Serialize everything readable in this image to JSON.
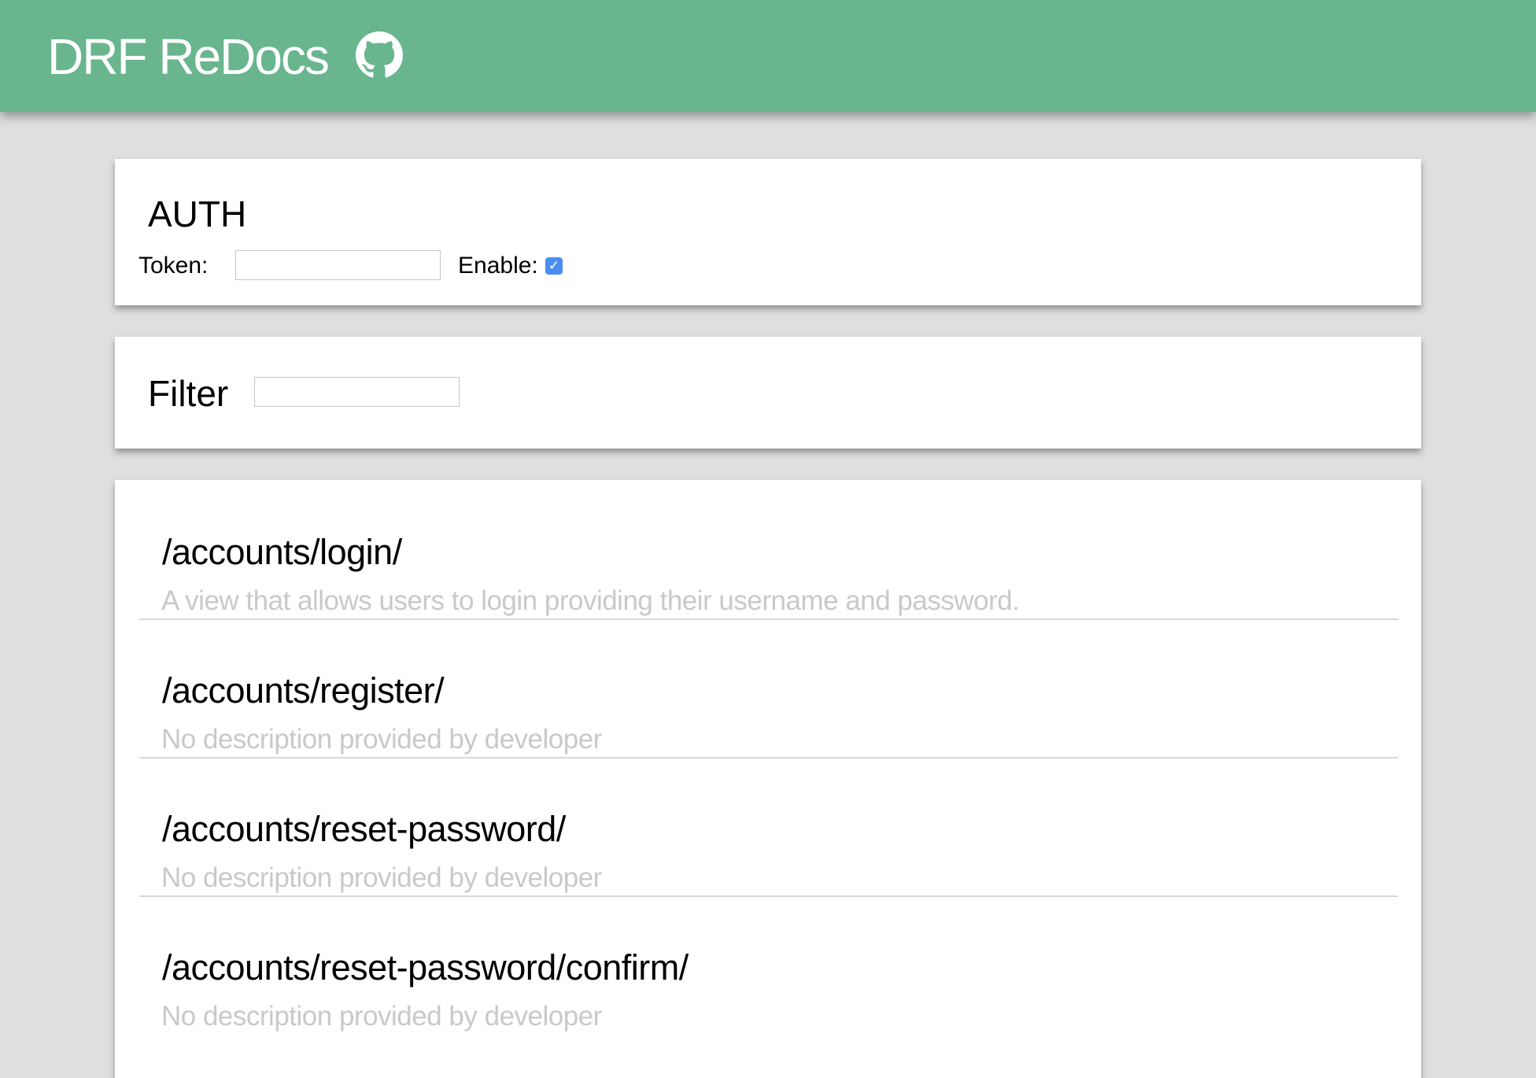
{
  "header": {
    "title": "DRF ReDocs",
    "icon": "github-icon"
  },
  "auth": {
    "title": "AUTH",
    "token_label": "Token:",
    "token_value": "",
    "enable_label": "Enable:",
    "enabled": true
  },
  "filter": {
    "label": "Filter",
    "value": ""
  },
  "endpoints": [
    {
      "path": "/accounts/login/",
      "description": "A view that allows users to login providing their username and password."
    },
    {
      "path": "/accounts/register/",
      "description": "No description provided by developer"
    },
    {
      "path": "/accounts/reset-password/",
      "description": "No description provided by developer"
    },
    {
      "path": "/accounts/reset-password/confirm/",
      "description": "No description provided by developer"
    }
  ],
  "colors": {
    "header": "#68b58e",
    "background": "#dfdfdf",
    "checkbox": "#4b8ef0",
    "description": "#c9c9c9"
  }
}
